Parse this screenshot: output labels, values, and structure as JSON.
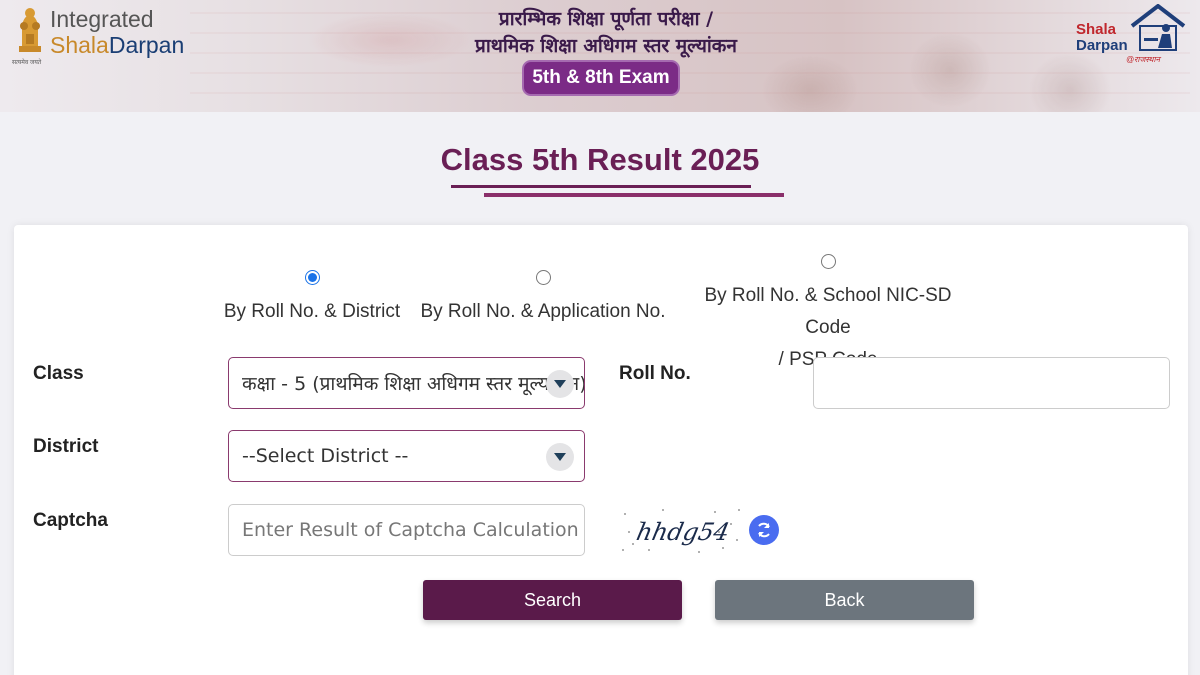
{
  "header": {
    "brand_line1": "Integrated",
    "brand_line2_part1": "Shala",
    "brand_line2_part2": "Darpan",
    "emblem_caption": "सत्यमेव जयते",
    "hindi_line1": "प्रारम्भिक शिक्षा पूर्णता परीक्षा /",
    "hindi_line2": "प्राथमिक शिक्षा अधिगम स्तर मूल्यांकन",
    "exam_badge": "5th & 8th Exam",
    "right_logo_line1": "Shala",
    "right_logo_line2": "Darpan",
    "right_logo_sub": "@राजस्थान"
  },
  "page_title": "Class 5th Result 2025",
  "search_options": [
    {
      "label": "By Roll No. & District",
      "checked": true
    },
    {
      "label": "By Roll No. & Application No.",
      "checked": false
    },
    {
      "label_line1": "By Roll No. & School NIC-SD Code",
      "label_line2": "/ PSP Code",
      "checked": false
    }
  ],
  "form": {
    "class_label": "Class",
    "class_value": "कक्षा - 5 (प्राथमिक शिक्षा अधिगम स्तर मूल्यांकन)",
    "roll_label": "Roll No.",
    "roll_value": "",
    "district_label": "District",
    "district_value": "--Select District --",
    "captcha_label": "Captcha",
    "captcha_placeholder": "Enter Result of Captcha Calculation",
    "captcha_text": "hhdg54"
  },
  "buttons": {
    "search": "Search",
    "back": "Back"
  },
  "colors": {
    "primary": "#5a1a4a",
    "title": "#6a1f55",
    "secondary_button": "#6c757d",
    "radio_accent": "#1a73e8"
  }
}
